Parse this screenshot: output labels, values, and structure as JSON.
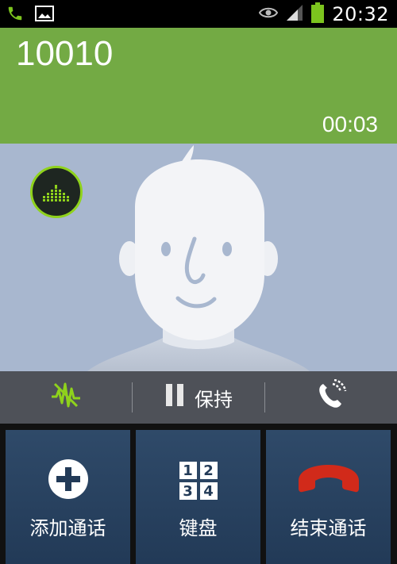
{
  "status_bar": {
    "time": "20:32",
    "icons": [
      "phone-icon",
      "image-icon",
      "eye-icon",
      "signal-icon",
      "battery-icon"
    ],
    "battery_color": "#7cc41e"
  },
  "call": {
    "number": "10010",
    "duration": "00:03",
    "header_color": "#73aa44"
  },
  "controls": {
    "hold_label": "保持"
  },
  "actions": {
    "add_call": "添加通话",
    "keypad": "键盘",
    "end_call": "结束通话",
    "keypad_digits": [
      "1",
      "2",
      "3",
      "4"
    ]
  },
  "colors": {
    "end_call_red": "#d12a1a",
    "noise_green": "#8fd21c"
  }
}
